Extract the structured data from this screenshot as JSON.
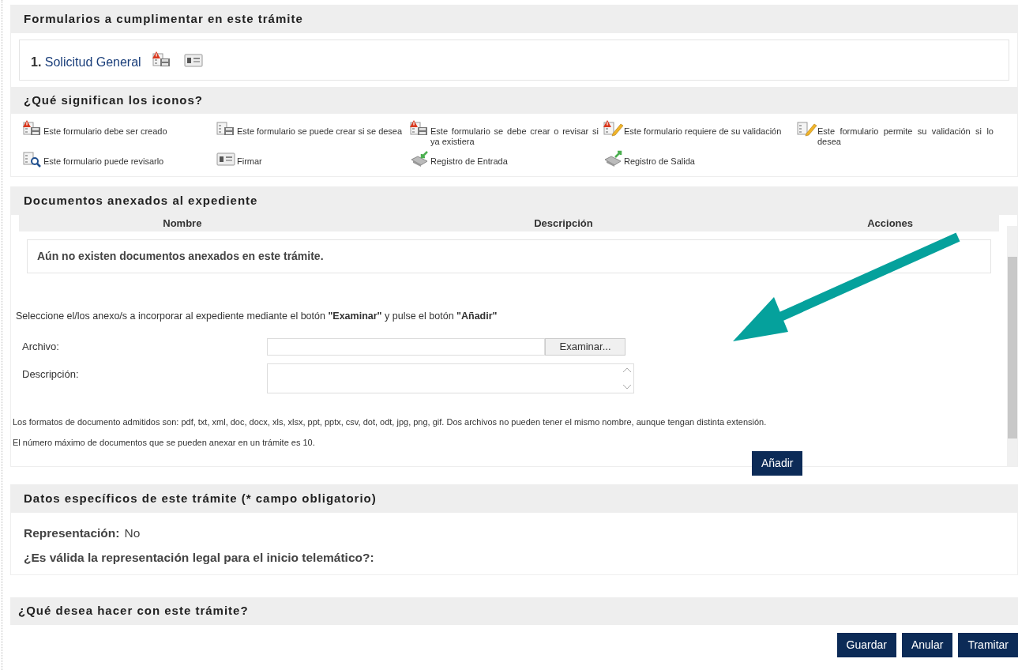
{
  "forms_section": {
    "title": "Formularios a cumplimentar en este trámite",
    "forms": [
      {
        "number": "1.",
        "name": "Solicitud General",
        "icons": [
          {
            "kind": "create-required"
          },
          {
            "kind": "sign"
          }
        ]
      }
    ]
  },
  "legend_section": {
    "title": "¿Qué significan los iconos?",
    "items": [
      {
        "kind": "create-required",
        "label": "Este formulario debe ser creado"
      },
      {
        "kind": "create-optional",
        "label": "Este formulario se puede crear si se desea"
      },
      {
        "kind": "create-or-review",
        "label": "Este formulario se debe crear o revisar si ya existiera"
      },
      {
        "kind": "validation-required",
        "label": "Este formulario requiere de su validación"
      },
      {
        "kind": "validation-optional",
        "label": "Este formulario permite su validación si lo desea"
      },
      {
        "kind": "review",
        "label": "Este formulario puede revisarlo"
      },
      {
        "kind": "sign",
        "label": "Firmar"
      },
      {
        "kind": "register-in",
        "label": "Registro de Entrada"
      },
      {
        "kind": "register-out",
        "label": "Registro de Salida"
      }
    ]
  },
  "documents_section": {
    "title": "Documentos anexados al expediente",
    "columns": [
      "Nombre",
      "Descripción",
      "Acciones"
    ],
    "empty_message": "Aún no existen documentos anexados en este trámite.",
    "instructions": "Seleccione el/los anexo/s a incorporar al expediente mediante el botón **\"Examinar\"** y pulse el botón **\"Añadir\"**",
    "file_label": "Archivo:",
    "browse_button": "Examinar...",
    "description_label": "Descripción:",
    "formats_note": "Los formatos de documento admitidos son: pdf, txt, xml, doc, docx, xls, xlsx, ppt, pptx, csv, dot, odt, jpg, png, gif. Dos archivos no pueden tener el mismo nombre, aunque tengan distinta extensión.",
    "limit_note": "El número máximo de documentos que se pueden anexar en un trámite es 10.",
    "add_button": "Añadir"
  },
  "specific_data_section": {
    "title": "Datos específicos de este trámite (* campo obligatorio)",
    "fields": [
      {
        "label": "Representación:",
        "value": "No"
      },
      {
        "label": "¿Es válida la representación legal para el inicio telemático?:"
      }
    ]
  },
  "actions_section": {
    "title": "¿Qué desea hacer con este trámite?",
    "buttons": [
      "Guardar",
      "Anular",
      "Tramitar"
    ]
  }
}
